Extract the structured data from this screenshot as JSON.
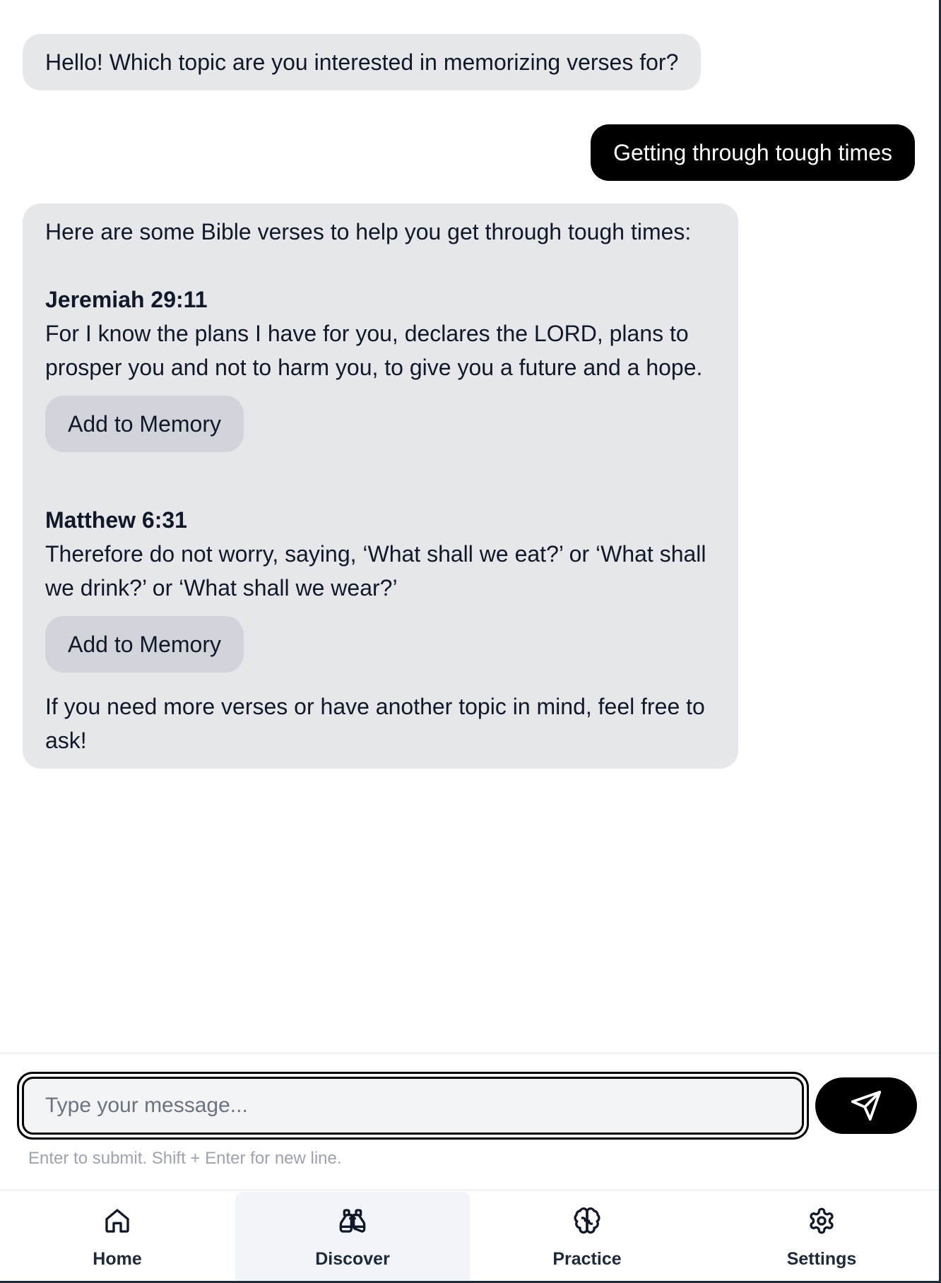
{
  "chat": {
    "greeting": "Hello! Which topic are you interested in memorizing verses for?",
    "user_message": "Getting through tough times",
    "answer": {
      "intro": "Here are some Bible verses to help you get through tough times:",
      "verses": [
        {
          "reference": "Jeremiah 29:11",
          "text": "For I know the plans I have for you, declares the LORD, plans to prosper you and not to harm you, to give you a future and a hope.",
          "button_label": "Add to Memory"
        },
        {
          "reference": "Matthew 6:31",
          "text": "Therefore do not worry, saying, ‘What shall we eat?’ or ‘What shall we drink?’ or ‘What shall we wear?’",
          "button_label": "Add to Memory"
        }
      ],
      "closing": "If you need more verses or have another topic in mind, feel free to ask!"
    }
  },
  "composer": {
    "placeholder": "Type your message...",
    "value": "",
    "hint": "Enter to submit. Shift + Enter for new line.",
    "send_icon": "send-icon"
  },
  "nav": {
    "items": [
      {
        "label": "Home",
        "icon": "home-icon",
        "active": false
      },
      {
        "label": "Discover",
        "icon": "binoculars-icon",
        "active": true
      },
      {
        "label": "Practice",
        "icon": "brain-icon",
        "active": false
      },
      {
        "label": "Settings",
        "icon": "gear-icon",
        "active": false
      }
    ]
  },
  "colors": {
    "assistant_bubble": "#e5e7eb",
    "user_bubble": "#000000",
    "memory_button": "#d1d5db",
    "active_nav": "#f1f5f9"
  }
}
